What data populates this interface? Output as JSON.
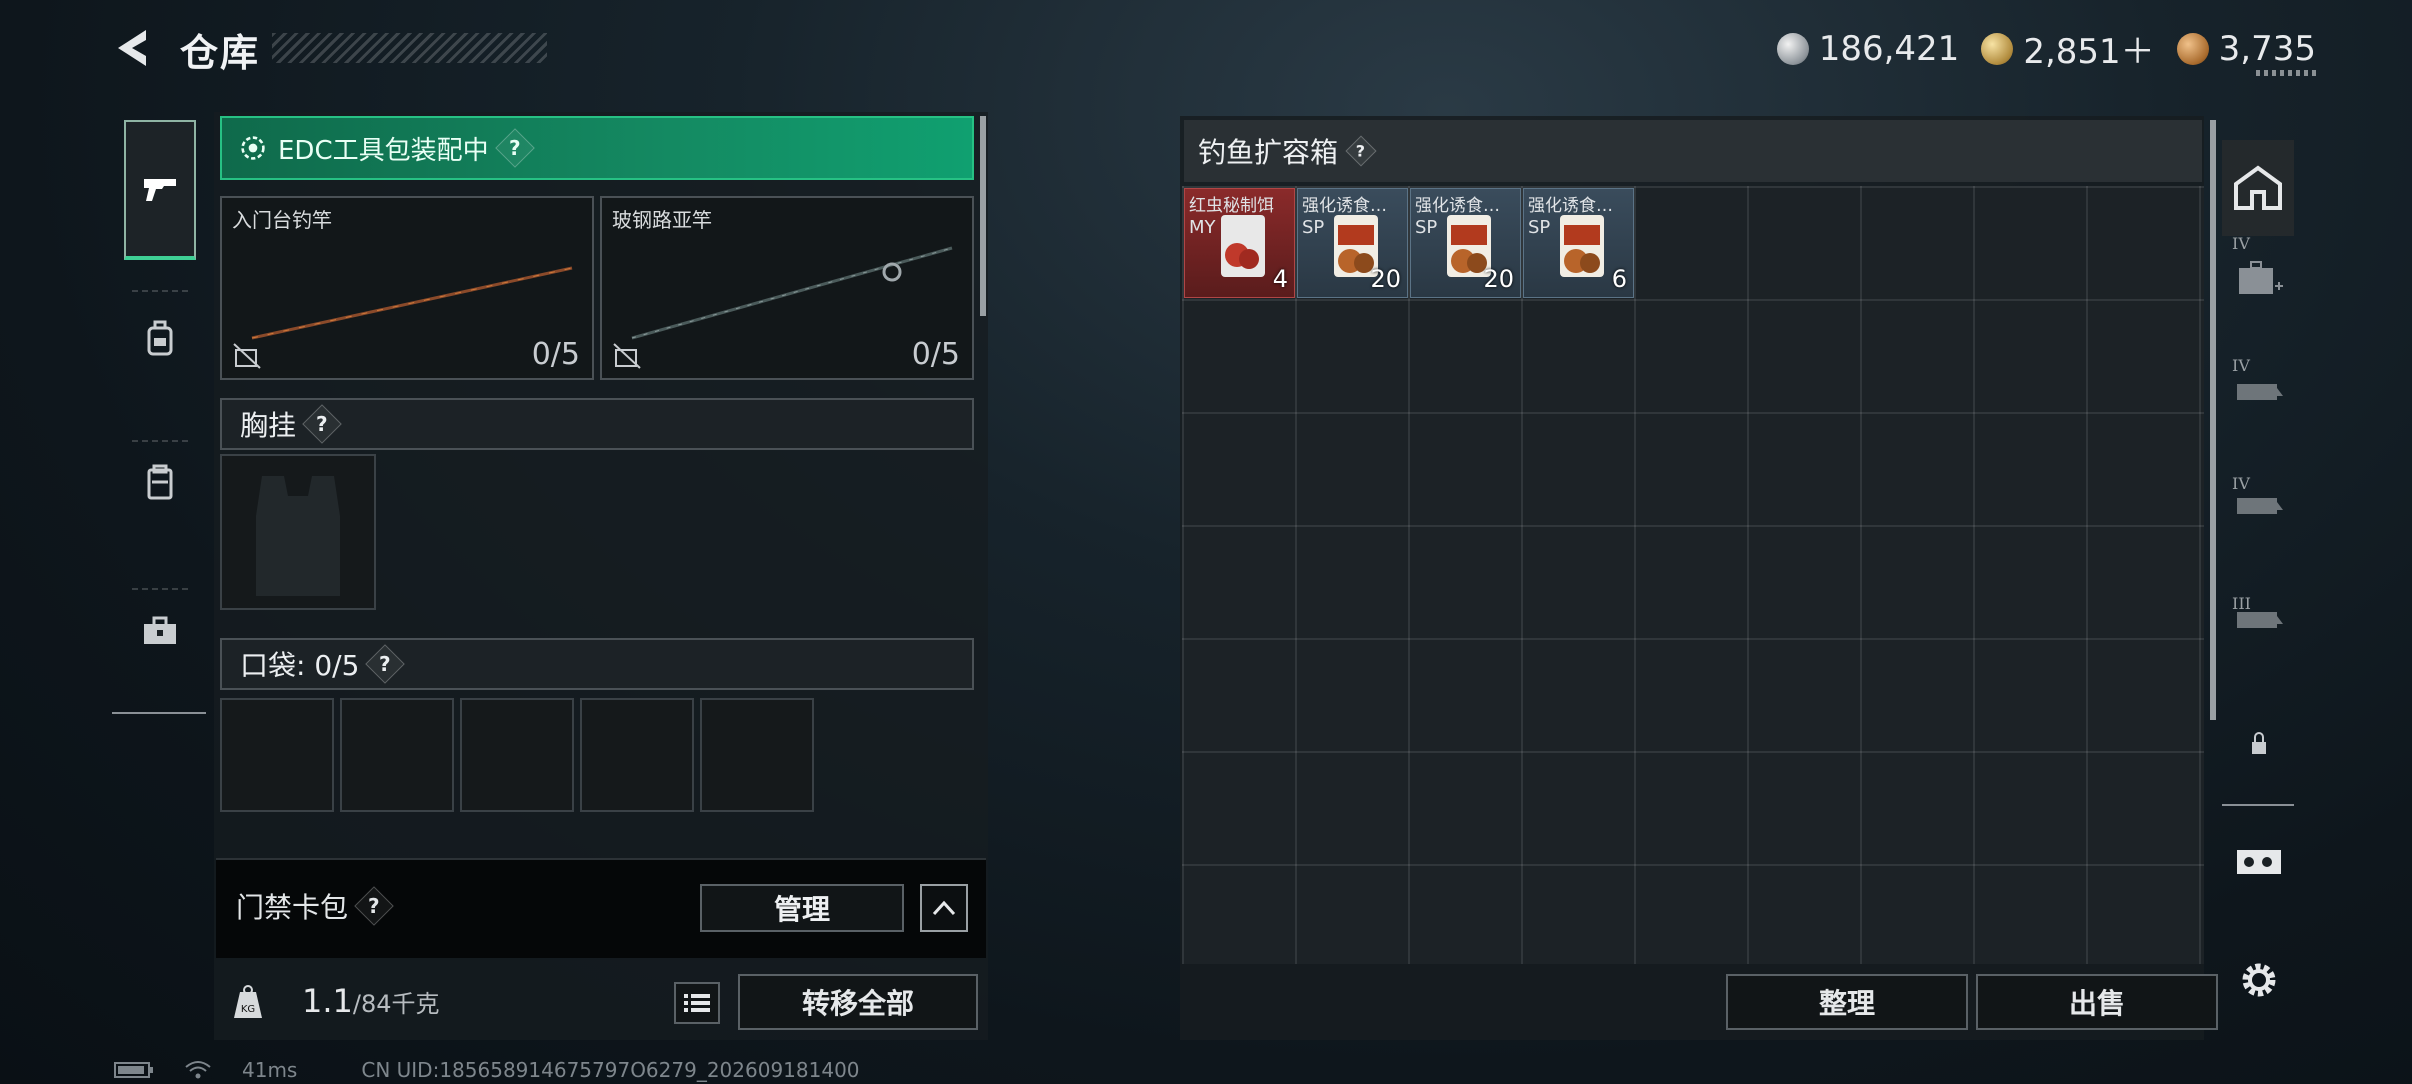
{
  "header": {
    "title": "仓库",
    "currencies": [
      {
        "type": "silver",
        "icon": "silver-coin-icon",
        "value": "186,421"
      },
      {
        "type": "gold",
        "icon": "gold-coin-icon",
        "value": "2,851＋"
      },
      {
        "type": "bronze",
        "icon": "bronze-coin-icon",
        "value": "3,735"
      }
    ]
  },
  "left_nav": {
    "items": [
      {
        "name": "weapon",
        "icon": "pistol-icon",
        "active": true
      },
      {
        "name": "backpack",
        "icon": "backpack-icon",
        "active": false
      },
      {
        "name": "vest",
        "icon": "vest-icon",
        "active": false
      },
      {
        "name": "toolkit",
        "icon": "toolbox-icon",
        "active": false
      }
    ]
  },
  "loadout": {
    "edc_status": "EDC工具包装配中",
    "rods": [
      {
        "name": "入门台钓竿",
        "count": "0/5"
      },
      {
        "name": "玻钢路亚竿",
        "count": "0/5"
      }
    ],
    "chest_rig_label": "胸挂",
    "pockets_label": "口袋: 0/5",
    "keycard_label": "门禁卡包",
    "manage_label": "管理",
    "weight_value": "1.1",
    "weight_capacity": "/84千克",
    "transfer_all_label": "转移全部"
  },
  "storage": {
    "title": "钓鱼扩容箱",
    "items": [
      {
        "name": "红虫秘制饵",
        "sub": "MY",
        "count": "4",
        "rarity": "red"
      },
      {
        "name": "强化诱食…",
        "sub": "SP",
        "count": "20",
        "rarity": "blue"
      },
      {
        "name": "强化诱食…",
        "sub": "SP",
        "count": "20",
        "rarity": "blue"
      },
      {
        "name": "强化诱食…",
        "sub": "SP",
        "count": "6",
        "rarity": "blue"
      }
    ],
    "sort_label": "整理",
    "sell_label": "出售"
  },
  "right_nav": {
    "tiers": [
      "IV",
      "IV",
      "IV",
      "III"
    ]
  },
  "status_bar": {
    "ping": "41ms",
    "uid": "CN UID:185658914675797O6279_202609181400"
  },
  "colors": {
    "accent_green": "#148a62",
    "rarity_red": "#8a2a2a",
    "rarity_blue": "#3a4c5c"
  }
}
